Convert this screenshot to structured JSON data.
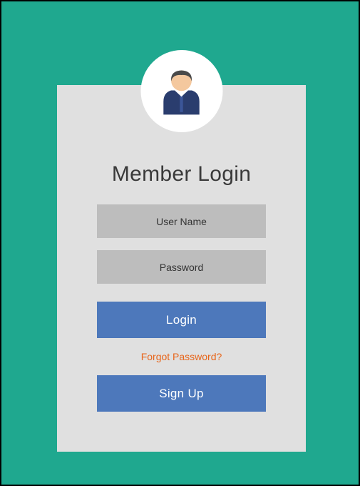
{
  "card": {
    "title": "Member Login",
    "username_placeholder": "User Name",
    "password_placeholder": "Password",
    "login_label": "Login",
    "forgot_label": "Forgot Password?",
    "signup_label": "Sign Up"
  }
}
